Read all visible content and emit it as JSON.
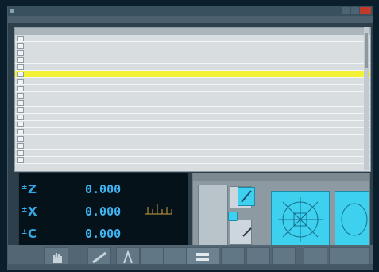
{
  "window": {
    "title": "",
    "menu_label": ""
  },
  "table": {
    "rows": [
      {
        "name": "",
        "date": "",
        "type": "",
        "info": ""
      },
      {
        "name": "",
        "date": "",
        "type": "",
        "info": ""
      },
      {
        "name": "",
        "date": "",
        "type": "",
        "info": ""
      },
      {
        "name": "",
        "date": "",
        "type": "",
        "info": ""
      },
      {
        "name": "",
        "date": "",
        "type": "",
        "info": ""
      },
      {
        "name": "",
        "date": "",
        "type": "",
        "info": ""
      },
      {
        "name": "",
        "date": "",
        "type": "",
        "info": ""
      },
      {
        "name": "",
        "date": "",
        "type": "",
        "info": ""
      },
      {
        "name": "",
        "date": "",
        "type": "",
        "info": ""
      },
      {
        "name": "",
        "date": "",
        "type": "",
        "info": ""
      },
      {
        "name": "",
        "date": "",
        "type": "",
        "info": ""
      },
      {
        "name": "",
        "date": "",
        "type": "",
        "info": ""
      },
      {
        "name": "",
        "date": "",
        "type": "",
        "info": ""
      },
      {
        "name": "",
        "date": "",
        "type": "",
        "info": ""
      },
      {
        "name": "",
        "date": "",
        "type": "",
        "info": ""
      },
      {
        "name": "",
        "date": "",
        "type": "",
        "info": ""
      },
      {
        "name": "",
        "date": "",
        "type": "",
        "info": ""
      },
      {
        "name": "",
        "date": "",
        "type": "",
        "info": ""
      }
    ],
    "selected_index": 5
  },
  "dro": {
    "axes": [
      {
        "sign": "±",
        "letter": "Z",
        "value": "0.000"
      },
      {
        "sign": "±",
        "letter": "X",
        "value": "0.000"
      },
      {
        "sign": "±",
        "letter": "C",
        "value": "0.000"
      }
    ]
  },
  "colors": {
    "selected_row": "#f2f135",
    "dro_text": "#3fb5f2",
    "preview": "#3dd0ef",
    "close_button": "#c23a2a"
  },
  "icons": {
    "toolbar": [
      "hand-icon",
      "measure-icon",
      "compass-icon",
      "tool-icon"
    ]
  }
}
